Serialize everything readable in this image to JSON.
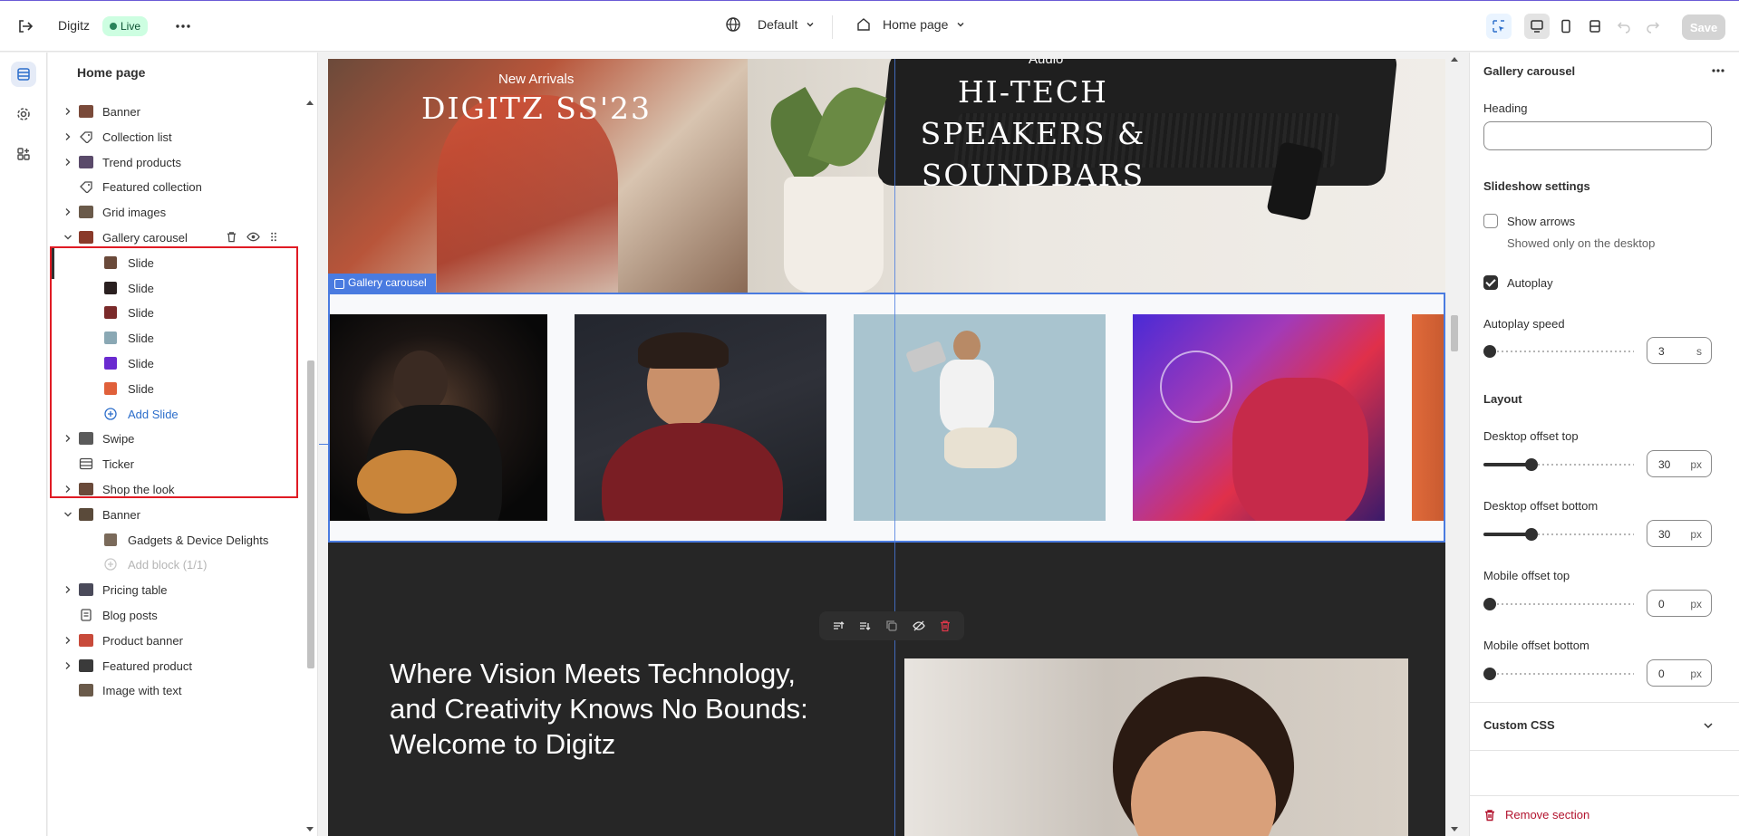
{
  "topbar": {
    "store_name": "Digitz",
    "status_badge": "Live",
    "theme_selector": "Default",
    "page_selector": "Home page",
    "save_label": "Save"
  },
  "sidebar": {
    "title": "Home page",
    "items": [
      {
        "label": "Banner"
      },
      {
        "label": "Collection list"
      },
      {
        "label": "Trend products"
      },
      {
        "label": "Featured collection"
      },
      {
        "label": "Grid images"
      },
      {
        "label": "Gallery carousel"
      },
      {
        "label": "Slide"
      },
      {
        "label": "Slide"
      },
      {
        "label": "Slide"
      },
      {
        "label": "Slide"
      },
      {
        "label": "Slide"
      },
      {
        "label": "Slide"
      },
      {
        "label": "Add Slide"
      },
      {
        "label": "Swipe"
      },
      {
        "label": "Ticker"
      },
      {
        "label": "Shop the look"
      },
      {
        "label": "Banner"
      },
      {
        "label": "Gadgets & Device Delights"
      },
      {
        "label": "Add block (1/1)"
      },
      {
        "label": "Pricing table"
      },
      {
        "label": "Blog posts"
      },
      {
        "label": "Product banner"
      },
      {
        "label": "Featured product"
      },
      {
        "label": "Image with text"
      }
    ]
  },
  "preview": {
    "banner_left_tag": "New Arrivals",
    "banner_left_heading": "DIGITZ SS'23",
    "banner_right_tag": "Audio",
    "banner_right_heading": "HI-TECH SPEAKERS & SOUNDBARS",
    "section_label": "Gallery carousel",
    "dark_heading": "Where Vision Meets Technology, and Creativity Knows No Bounds: Welcome to Digitz"
  },
  "panel": {
    "title": "Gallery carousel",
    "heading_label": "Heading",
    "heading_value": "",
    "slideshow_settings": "Slideshow settings",
    "show_arrows_label": "Show arrows",
    "show_arrows_checked": false,
    "show_arrows_help": "Showed only on the desktop",
    "autoplay_label": "Autoplay",
    "autoplay_checked": true,
    "autoplay_speed_label": "Autoplay speed",
    "autoplay_speed_value": "3",
    "autoplay_speed_unit": "s",
    "layout_heading": "Layout",
    "desktop_offset_top_label": "Desktop offset top",
    "desktop_offset_top_value": "30",
    "desktop_offset_bottom_label": "Desktop offset bottom",
    "desktop_offset_bottom_value": "30",
    "mobile_offset_top_label": "Mobile offset top",
    "mobile_offset_top_value": "0",
    "mobile_offset_bottom_label": "Mobile offset bottom",
    "mobile_offset_bottom_value": "0",
    "px_unit": "px",
    "custom_css_label": "Custom CSS",
    "remove_label": "Remove section"
  },
  "colors": {
    "accent_blue": "#4a7be0",
    "selection_red": "#e01b24",
    "live_green": "#cdfee1",
    "danger": "#b2132e"
  }
}
